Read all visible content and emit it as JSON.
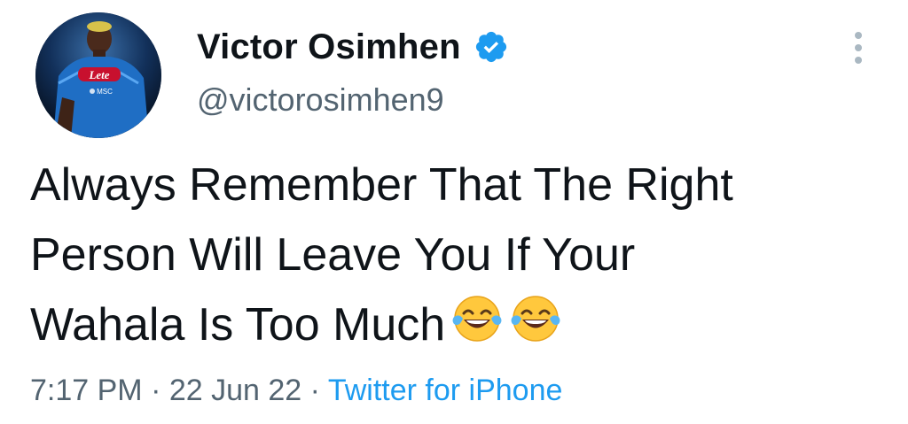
{
  "tweet": {
    "author": {
      "display_name": "Victor Osimhen",
      "handle": "@victorosimhen9",
      "verified": true,
      "avatar_jersey_text": "Lete",
      "avatar_sponsor_text": "MSC"
    },
    "text_lines": [
      "Always Remember That The Right",
      "Person Will Leave You If Your",
      "Wahala Is Too Much"
    ],
    "emojis": [
      "face-with-tears-of-joy",
      "face-with-tears-of-joy"
    ],
    "time": "7:17 PM",
    "separator": "·",
    "date": "22 Jun 22",
    "source": "Twitter for iPhone"
  },
  "colors": {
    "text": "#0f1419",
    "secondary": "#536471",
    "link": "#1d9bf0",
    "verified_badge": "#1d9bf0"
  }
}
